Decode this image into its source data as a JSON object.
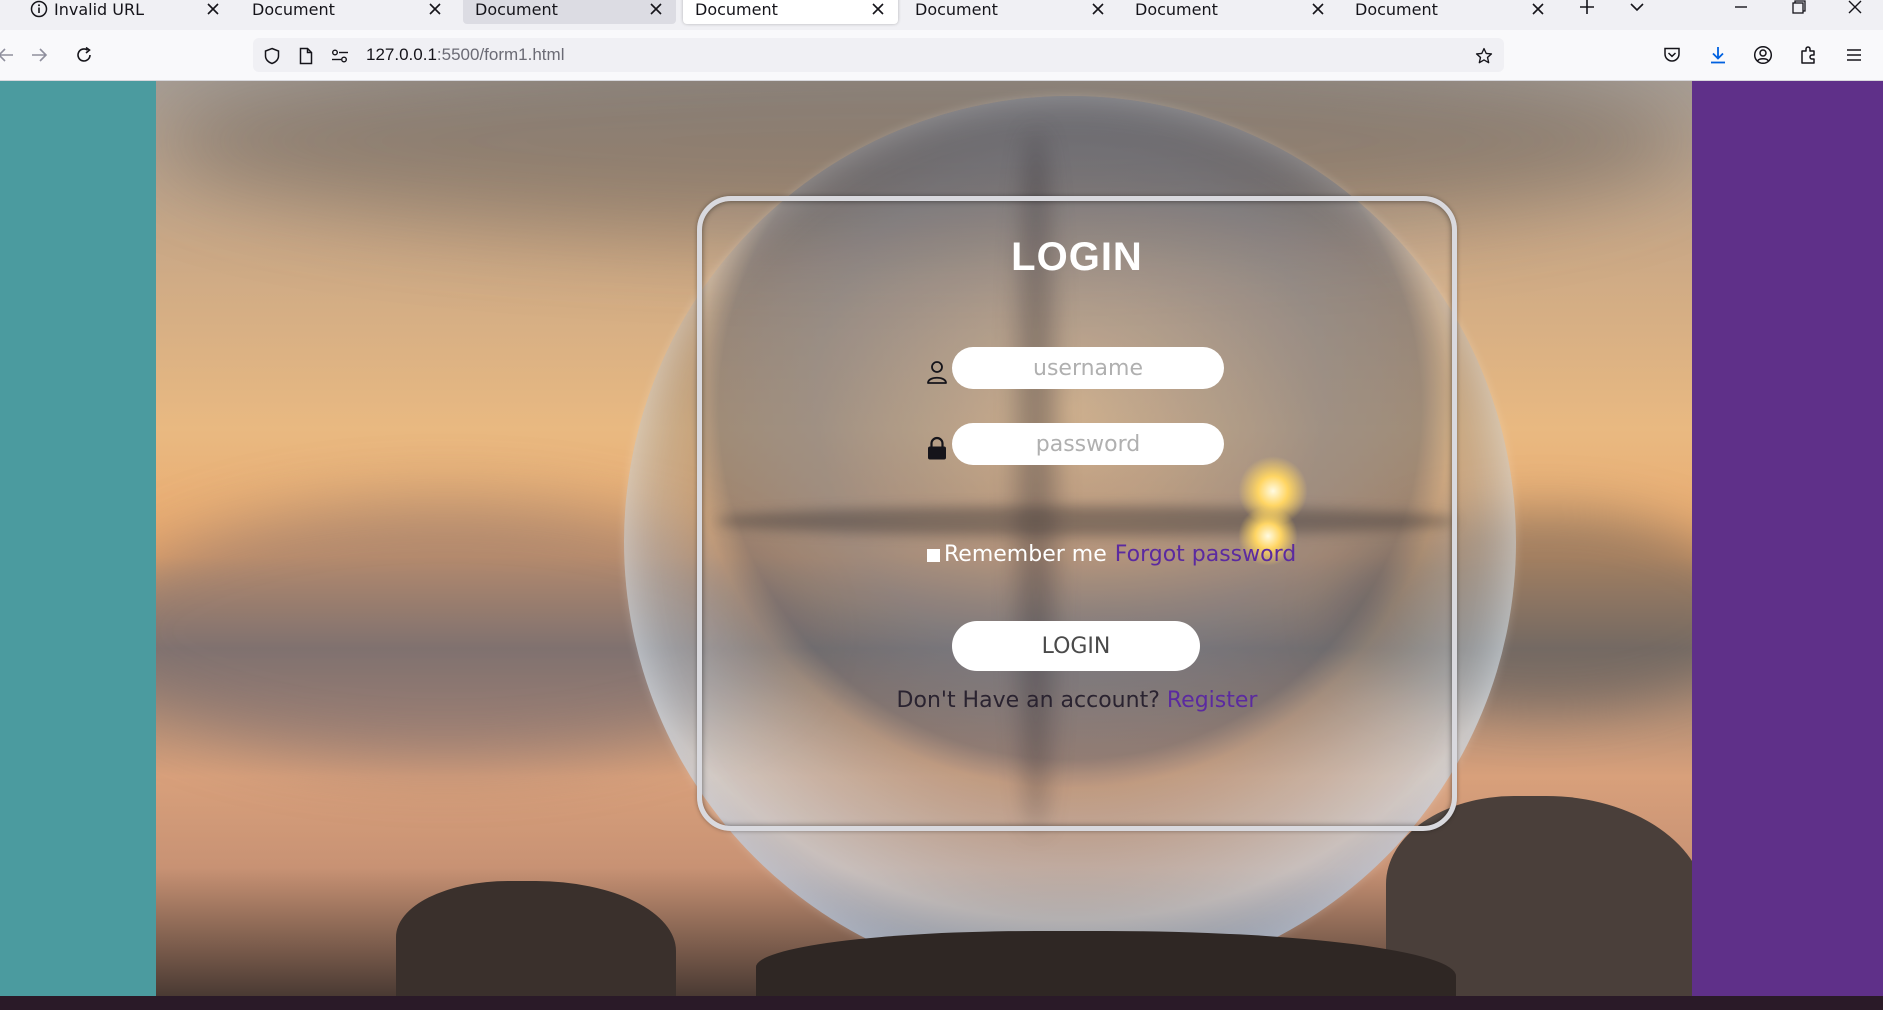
{
  "browser": {
    "tabs": [
      {
        "title": "Invalid URL",
        "state": "normal",
        "has_info_icon": true
      },
      {
        "title": "Document",
        "state": "normal"
      },
      {
        "title": "Document",
        "state": "hover"
      },
      {
        "title": "Document",
        "state": "active"
      },
      {
        "title": "Document",
        "state": "normal"
      },
      {
        "title": "Document",
        "state": "normal"
      },
      {
        "title": "Document",
        "state": "normal"
      }
    ],
    "url": {
      "host": "127.0.0.1",
      "path": ":5500/form1.html"
    },
    "icons": {
      "back": "arrow-left-icon",
      "forward": "arrow-right-icon",
      "reload": "reload-icon",
      "shield": "shield-icon",
      "page": "page-icon",
      "permissions": "permissions-icon",
      "bookmark": "star-icon",
      "pocket": "pocket-icon",
      "downloads": "download-icon",
      "account": "account-icon",
      "extensions": "extensions-icon",
      "menu": "hamburger-menu-icon"
    }
  },
  "page": {
    "colors": {
      "left_panel": "#4b9b9f",
      "right_panel": "#5f3089",
      "link": "#5b2aa0"
    },
    "login": {
      "title": "LOGIN",
      "username_placeholder": "username",
      "password_placeholder": "password",
      "remember_label": "Remember me",
      "forgot_link": "Forgot password",
      "submit_label": "LOGIN",
      "register_prompt": "Don't Have an account?",
      "register_link": "Register",
      "icons": {
        "username": "user-icon",
        "password": "lock-icon"
      }
    }
  }
}
